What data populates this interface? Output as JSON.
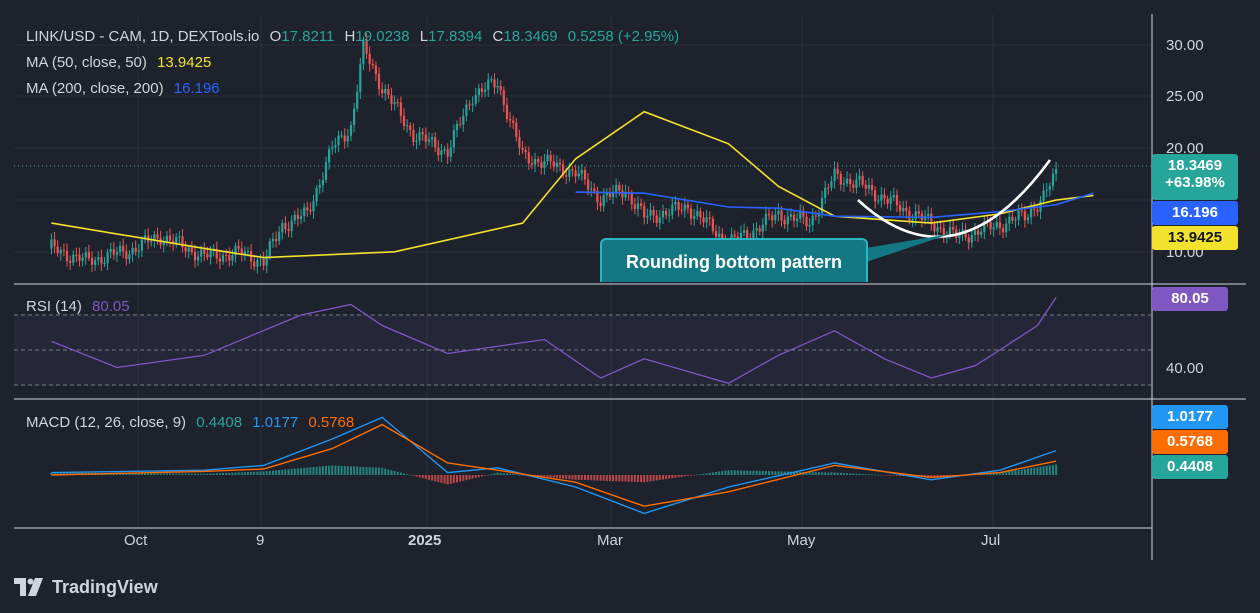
{
  "header": {
    "symbol": "LINK/USD - CAM, 1D, DEXTools.io",
    "open_label": "O",
    "open": "17.8211",
    "high_label": "H",
    "high": "19.0238",
    "low_label": "L",
    "low": "17.8394",
    "close_label": "C",
    "close": "18.3469",
    "change": "0.5258 (+2.95%)"
  },
  "ma_legends": [
    {
      "label": "MA (50, close, 50)",
      "value": "13.9425"
    },
    {
      "label": "MA (200, close, 200)",
      "value": "16.196"
    }
  ],
  "rsi_legend": {
    "label": "RSI (14)",
    "value": "80.05"
  },
  "macd_legend": {
    "label": "MACD (12, 26, close, 9)",
    "hist": "0.4408",
    "macd": "1.0177",
    "signal": "0.5768"
  },
  "badges": {
    "price": "18.3469",
    "price_change": "+63.98%",
    "ma200": "16.196",
    "ma50": "13.9425",
    "rsi": "80.05",
    "macd": "1.0177",
    "signal": "0.5768",
    "hist": "0.4408"
  },
  "annotation": "Rounding bottom pattern",
  "logo": "TradingView",
  "colors": {
    "background": "#1e222d",
    "up": "#26a69a",
    "down": "#ef5350",
    "ma50": "#f2e22e",
    "ma200": "#2962ff",
    "rsi": "#7e57c2",
    "macd": "#2196f3",
    "signal": "#ff6d00",
    "annotation": "#137883"
  },
  "icons": {
    "logo": "tradingview-logo-icon"
  },
  "chart_data": [
    {
      "type": "candlestick",
      "title": "LINK/USD - CAM, 1D, DEXTools.io",
      "x_ticks": [
        "Oct",
        "9",
        "2025",
        "Mar",
        "May",
        "Jul"
      ],
      "y_ticks": [
        "30.00",
        "25.00",
        "20.00",
        "10.00"
      ],
      "ylim": [
        8.7,
        32.2
      ],
      "grid": true,
      "last_price": 18.3469,
      "series": [
        {
          "name": "Price",
          "x": [
            "Sep 1",
            "Sep 12",
            "Sep 26",
            "Oct 6",
            "Oct 20",
            "Nov 1",
            "Nov 8",
            "Nov 14",
            "Nov 22",
            "Nov 30",
            "Dec 6",
            "Dec 10",
            "Dec 16",
            "Dec 26",
            "Jan 6",
            "Jan 14",
            "Jan 22",
            "Jan 30",
            "Feb 6",
            "Feb 16",
            "Feb 24",
            "Mar 4",
            "Mar 10",
            "Mar 24",
            "Apr 6",
            "Apr 12",
            "Apr 22",
            "May 2",
            "May 10",
            "May 18",
            "Jun 1",
            "Jun 10",
            "Jun 18",
            "Jun 24",
            "Jul 2",
            "Jul 10",
            "Jul 16",
            "Jul 20"
          ],
          "y": [
            11.8,
            10.7,
            11.6,
            12.9,
            11.1,
            11.4,
            10.6,
            13.8,
            14.8,
            20.5,
            22.4,
            29.2,
            25.8,
            21.7,
            20.2,
            25.2,
            26.2,
            19.8,
            19.3,
            18.4,
            16.1,
            16.9,
            14.5,
            15.4,
            12.3,
            13.0,
            14.8,
            14.0,
            18.1,
            17.4,
            15.2,
            14.0,
            12.8,
            13.2,
            13.9,
            14.6,
            16.2,
            18.35
          ]
        },
        {
          "name": "MA (50, close, 50)",
          "x": [
            "Sep 1",
            "Oct 20",
            "Nov 8",
            "Dec 20",
            "Jan 30",
            "Feb 16",
            "Mar 10",
            "Apr 6",
            "Apr 22",
            "May 10",
            "Jun 10",
            "Jul 2",
            "Jul 20",
            "Aug 1"
          ],
          "y": [
            14.0,
            11.8,
            11.0,
            11.5,
            14.0,
            19.6,
            23.7,
            20.9,
            17.2,
            14.6,
            14.0,
            14.8,
            16.0,
            16.4
          ]
        },
        {
          "name": "MA (200, close, 200)",
          "x": [
            "Feb 16",
            "Mar 10",
            "Apr 6",
            "Apr 22",
            "May 10",
            "Jun 10",
            "Jul 2",
            "Jul 20",
            "Aug 1"
          ],
          "y": [
            16.7,
            16.6,
            15.4,
            15.3,
            14.6,
            14.5,
            15.0,
            15.6,
            16.6
          ]
        }
      ]
    },
    {
      "type": "line",
      "title": "RSI (14)",
      "y_ticks": [
        "40.00"
      ],
      "levels": [
        70,
        50,
        30
      ],
      "series": [
        {
          "name": "RSI (14)",
          "x": [
            "Sep 1",
            "Sep 22",
            "Oct 20",
            "Nov 20",
            "Dec 6",
            "Dec 16",
            "Jan 6",
            "Feb 6",
            "Feb 24",
            "Mar 10",
            "Apr 6",
            "Apr 22",
            "May 10",
            "May 26",
            "Jun 10",
            "Jun 24",
            "Jul 2",
            "Jul 14",
            "Jul 20"
          ],
          "y": [
            55,
            40,
            47,
            70,
            76,
            64,
            48,
            56,
            34,
            45,
            31,
            47,
            61,
            45,
            34,
            41,
            50,
            64,
            80.05
          ]
        }
      ]
    },
    {
      "type": "line",
      "title": "MACD (12, 26, close, 9)",
      "series": [
        {
          "name": "MACD",
          "x": [
            "Sep 1",
            "Oct 20",
            "Nov 8",
            "Nov 30",
            "Dec 16",
            "Jan 6",
            "Jan 22",
            "Feb 16",
            "Mar 10",
            "Apr 6",
            "May 10",
            "Jun 10",
            "Jul 2",
            "Jul 20"
          ],
          "y": [
            0.1,
            0.2,
            0.4,
            1.5,
            2.4,
            0.1,
            0.3,
            -0.5,
            -1.6,
            -0.5,
            0.5,
            -0.2,
            0.2,
            1.0177
          ]
        },
        {
          "name": "Signal",
          "x": [
            "Sep 1",
            "Oct 20",
            "Nov 8",
            "Nov 30",
            "Dec 16",
            "Jan 6",
            "Jan 22",
            "Feb 16",
            "Mar 10",
            "Apr 6",
            "May 10",
            "Jun 10",
            "Jul 2",
            "Jul 20"
          ],
          "y": [
            0.0,
            0.15,
            0.25,
            1.1,
            2.1,
            0.5,
            0.2,
            -0.3,
            -1.3,
            -0.7,
            0.4,
            -0.1,
            0.1,
            0.5768
          ]
        }
      ]
    }
  ]
}
